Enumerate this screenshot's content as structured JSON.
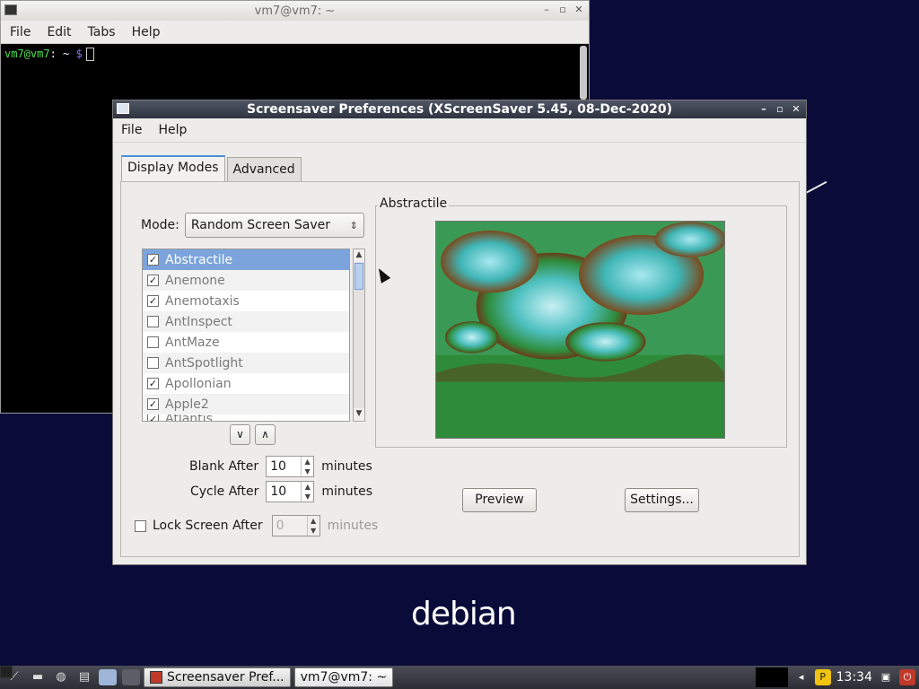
{
  "terminal": {
    "title": "vm7@vm7: ~",
    "menu": [
      "File",
      "Edit",
      "Tabs",
      "Help"
    ],
    "prompt_user": "vm7@vm7",
    "prompt_path": ": ~",
    "prompt_symbol": "$"
  },
  "dialog": {
    "title": "Screensaver Preferences  (XScreenSaver 5.45, 08-Dec-2020)",
    "menu": [
      "File",
      "Help"
    ],
    "tabs": [
      "Display Modes",
      "Advanced"
    ],
    "mode_label": "Mode:",
    "mode_value": "Random Screen Saver",
    "list_items": [
      {
        "label": "Abstractile",
        "checked": true,
        "selected": true
      },
      {
        "label": "Anemone",
        "checked": true,
        "selected": false
      },
      {
        "label": "Anemotaxis",
        "checked": true,
        "selected": false
      },
      {
        "label": "AntInspect",
        "checked": false,
        "selected": false
      },
      {
        "label": "AntMaze",
        "checked": false,
        "selected": false
      },
      {
        "label": "AntSpotlight",
        "checked": false,
        "selected": false
      },
      {
        "label": "Apollonian",
        "checked": true,
        "selected": false
      },
      {
        "label": "Apple2",
        "checked": true,
        "selected": false
      },
      {
        "label": "Atlantis",
        "checked": true,
        "selected": false
      }
    ],
    "blank_after_label": "Blank After",
    "blank_after_value": "10",
    "cycle_after_label": "Cycle After",
    "cycle_after_value": "10",
    "lock_label": "Lock Screen After",
    "lock_value": "0",
    "minutes_label": "minutes",
    "preview_title": "Abstractile",
    "preview_button": "Preview",
    "settings_button": "Settings..."
  },
  "desktop": {
    "logo_text": "debian"
  },
  "taskbar": {
    "tasks": [
      "Screensaver Pref...",
      "vm7@vm7: ~"
    ],
    "clock": "13:34"
  },
  "colors": {
    "desktop_bg": "#0b0b3a",
    "selection": "#7ba4dc",
    "title_bar": "#2e3440"
  }
}
